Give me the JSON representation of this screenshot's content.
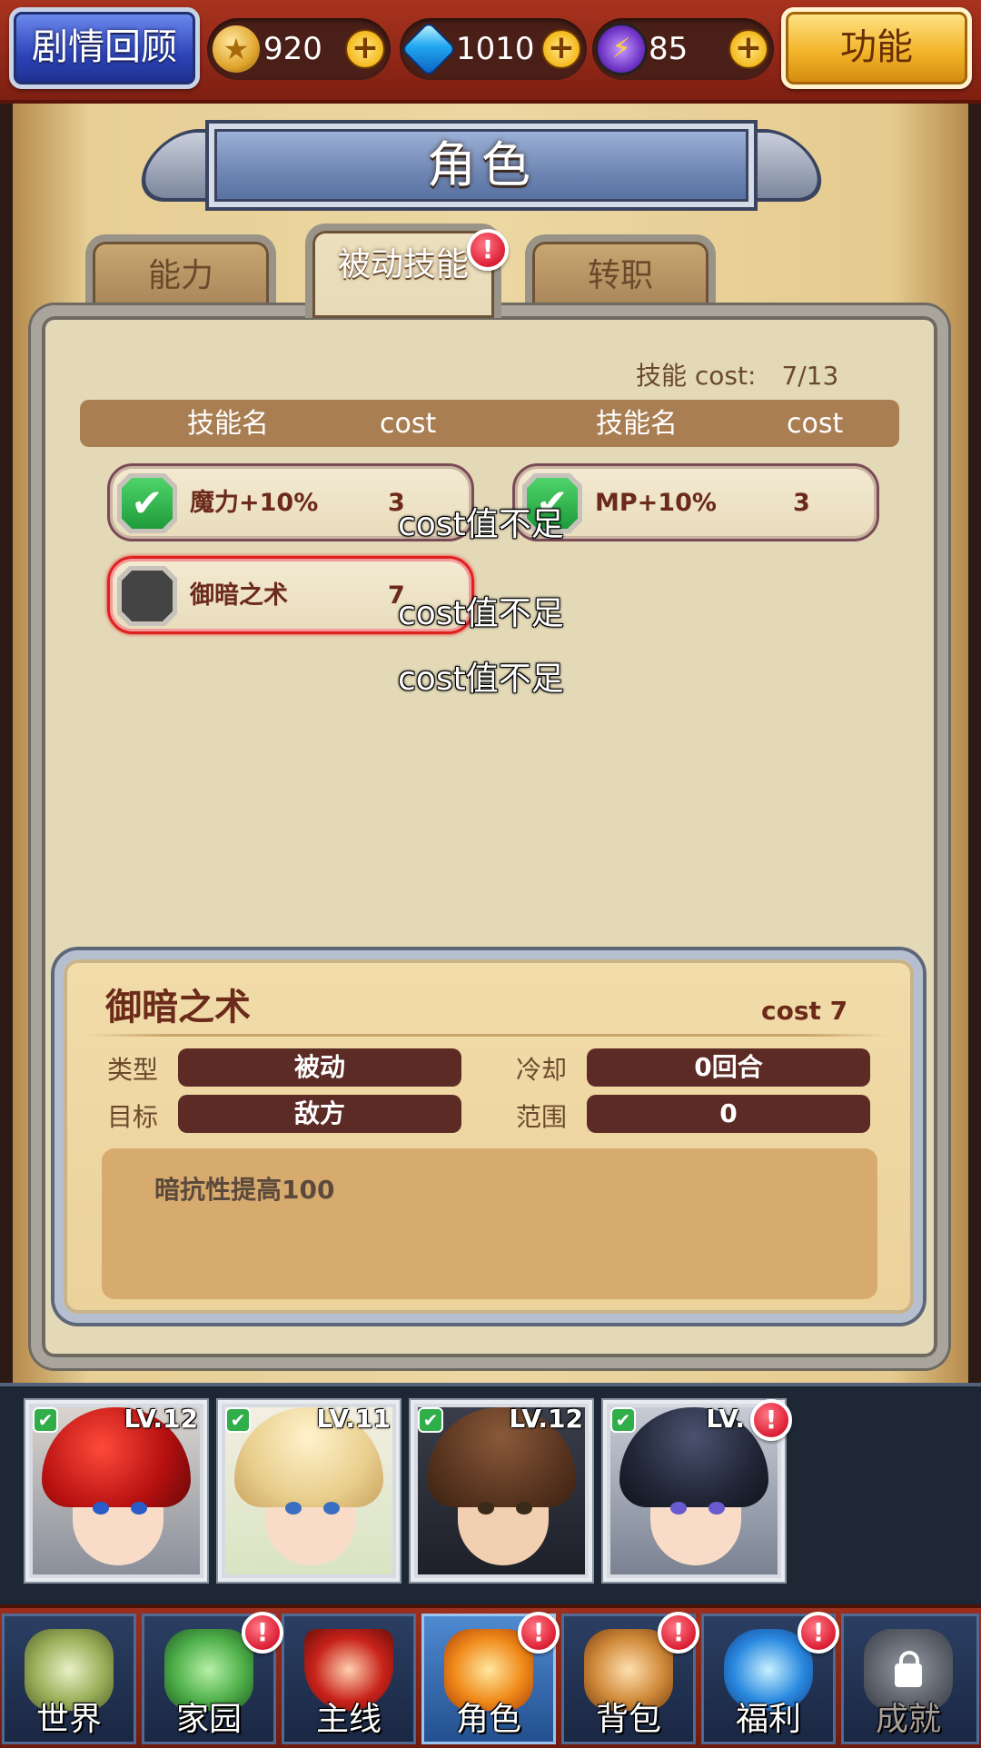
{
  "topbar": {
    "story_label": "剧情回顾",
    "resources": [
      {
        "icon": "coin-icon",
        "value": "920"
      },
      {
        "icon": "gem-icon",
        "value": "1010"
      },
      {
        "icon": "energy-icon",
        "value": "85"
      }
    ],
    "function_label": "功能"
  },
  "page_title": "角色",
  "tabs": [
    {
      "label": "能力",
      "active": false
    },
    {
      "label": "被动技能",
      "active": true,
      "badge": "!"
    },
    {
      "label": "转职",
      "active": false
    }
  ],
  "skill_panel": {
    "cost_label": "技能 cost:",
    "cost_value": "7/13",
    "headers": {
      "name": "技能名",
      "cost": "cost"
    },
    "skills": [
      {
        "name": "魔力+10%",
        "cost": "3",
        "equipped": true,
        "selected": false
      },
      {
        "name": "MP+10%",
        "cost": "3",
        "equipped": true,
        "selected": false
      },
      {
        "name": "御暗之术",
        "cost": "7",
        "equipped": false,
        "selected": true
      }
    ],
    "toasts": [
      "cost值不足",
      "cost值不足",
      "cost值不足"
    ]
  },
  "detail": {
    "name": "御暗之术",
    "cost": "cost 7",
    "type_label": "类型",
    "type_value": "被动",
    "cooldown_label": "冷却",
    "cooldown_value": "0回合",
    "target_label": "目标",
    "target_value": "敌方",
    "range_label": "范围",
    "range_value": "0",
    "description": "暗抗性提高100"
  },
  "party": [
    {
      "level": "LV.12",
      "selected": true
    },
    {
      "level": "LV.11",
      "selected": true
    },
    {
      "level": "LV.12",
      "selected": true
    },
    {
      "level": "LV.",
      "selected": true,
      "badge": "!"
    }
  ],
  "bottom_nav": [
    {
      "label": "世界",
      "badge": null,
      "active": false,
      "locked": false
    },
    {
      "label": "家园",
      "badge": "!",
      "active": false,
      "locked": false
    },
    {
      "label": "主线",
      "badge": null,
      "active": false,
      "locked": false
    },
    {
      "label": "角色",
      "badge": "!",
      "active": true,
      "locked": false
    },
    {
      "label": "背包",
      "badge": "!",
      "active": false,
      "locked": false
    },
    {
      "label": "福利",
      "badge": "!",
      "active": false,
      "locked": false
    },
    {
      "label": "成就",
      "badge": null,
      "active": false,
      "locked": true
    }
  ],
  "colors": {
    "topbar": "#8e2818",
    "accent_red": "#e0243a",
    "check_green": "#2fae4a",
    "parchment": "#e3d9b7",
    "brown_text": "#6b2a1a"
  }
}
